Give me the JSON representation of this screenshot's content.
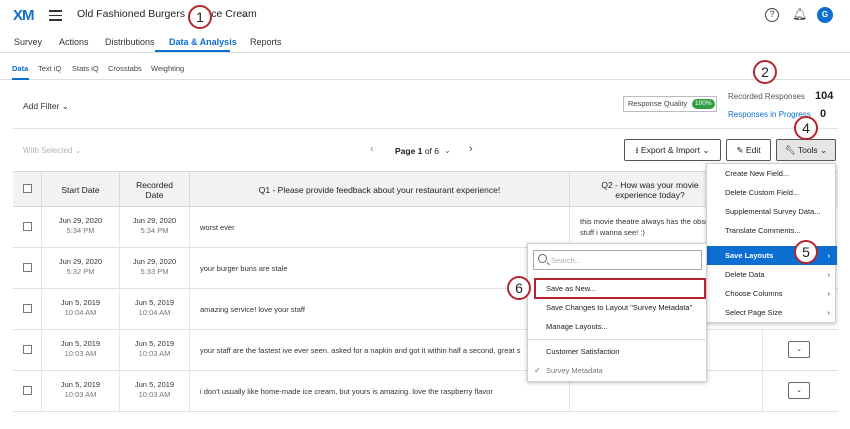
{
  "app": {
    "logo": "XM",
    "project_title": "Old Fashioned Burgers and Ice Cream",
    "avatar_initial": "G"
  },
  "nav_tabs": [
    {
      "label": "Survey"
    },
    {
      "label": "Actions"
    },
    {
      "label": "Distributions"
    },
    {
      "label": "Data & Analysis",
      "active": true
    },
    {
      "label": "Reports"
    }
  ],
  "sub_tabs": [
    {
      "label": "Data",
      "active": true
    },
    {
      "label": "Text iQ"
    },
    {
      "label": "Stats iQ"
    },
    {
      "label": "Crosstabs"
    },
    {
      "label": "Weighting"
    }
  ],
  "filters": {
    "add_filter": "Add Filter",
    "response_quality": "Response Quality",
    "quality_pct": "100%"
  },
  "stats": {
    "recorded_label": "Recorded Responses",
    "recorded_value": "104",
    "progress_label": "Responses in Progress",
    "progress_value": "0"
  },
  "toolbar": {
    "with_selected": "With Selected",
    "page_prefix": "Page",
    "page_current": "1",
    "page_of": "of 6",
    "export_label": "Export & Import",
    "edit_label": "Edit",
    "tools_label": "Tools"
  },
  "table": {
    "headers": {
      "start_date": "Start Date",
      "recorded_date": "Recorded Date",
      "q1": "Q1 - Please provide feedback about your restaurant experience!",
      "q2": "Q2 - How was your movie experience today?"
    },
    "rows": [
      {
        "start_date": "Jun 29, 2020",
        "start_time": "5:34 PM",
        "rec_date": "Jun 29, 2020",
        "rec_time": "5:34 PM",
        "q1": "worst ever",
        "q2": "this movie theatre always has the obscure stuff i wanna see! :)"
      },
      {
        "start_date": "Jun 29, 2020",
        "start_time": "5:32 PM",
        "rec_date": "Jun 29, 2020",
        "rec_time": "5:33 PM",
        "q1": "your burger buns are stale",
        "q2": ""
      },
      {
        "start_date": "Jun 5, 2019",
        "start_time": "10:04 AM",
        "rec_date": "Jun 5, 2019",
        "rec_time": "10:04 AM",
        "q1": "amazing service! love your staff",
        "q2": ""
      },
      {
        "start_date": "Jun 5, 2019",
        "start_time": "10:03 AM",
        "rec_date": "Jun 5, 2019",
        "rec_time": "10:03 AM",
        "q1": "your staff are the fastest ive ever seen. asked for a napkin and got it within half a second, great s",
        "q2": ""
      },
      {
        "start_date": "Jun 5, 2019",
        "start_time": "10:03 AM",
        "rec_date": "Jun 5, 2019",
        "rec_time": "10:03 AM",
        "q1": "i don't usually like home-made ice cream, but yours is amazing. love the raspberry flavor",
        "q2": ""
      }
    ]
  },
  "tools_menu": {
    "items": [
      {
        "label": "Create New Field..."
      },
      {
        "label": "Delete Custom Field..."
      },
      {
        "label": "Supplemental Survey Data..."
      },
      {
        "label": "Translate Comments..."
      },
      {
        "label": "Save Layouts",
        "active": true
      },
      {
        "label": "Delete Data"
      },
      {
        "label": "Choose Columns"
      },
      {
        "label": "Select Page Size"
      }
    ]
  },
  "layouts_submenu": {
    "search_placeholder": "Search...",
    "items": [
      {
        "label": "Save as New..."
      },
      {
        "label": "Save Changes to Layout \"Survey Metadata\""
      },
      {
        "label": "Manage Layouts..."
      },
      {
        "label": "Customer Satisfaction"
      },
      {
        "label": "Survey Metadata"
      }
    ]
  },
  "callouts": [
    "1",
    "2",
    "4",
    "5",
    "6"
  ],
  "colors": {
    "accent": "#0b6ed0",
    "callout_border": "#b3262e",
    "quality_green": "#2f9e44"
  }
}
